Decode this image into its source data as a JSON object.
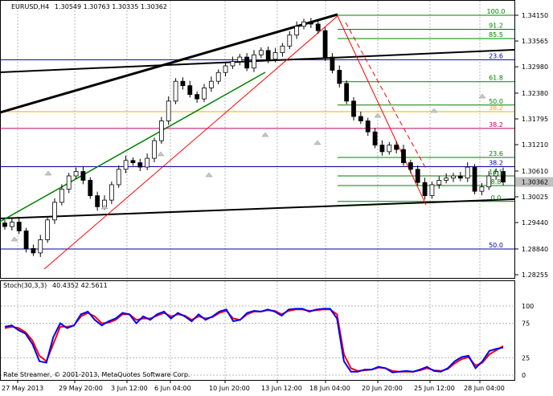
{
  "header": {
    "symbol": "EURUSD,H4",
    "ohlc": "1.30549 1.30763 1.30335 1.30362"
  },
  "chart_data": [
    {
      "type": "candlestick",
      "symbol": "EURUSD",
      "timeframe": "H4",
      "open": 1.30549,
      "high": 1.30763,
      "low": 1.30335,
      "close": 1.30362,
      "ylim": [
        1.28255,
        1.3415
      ],
      "price_ticks": [
        "1.34150",
        "1.33565",
        "1.32980",
        "1.32380",
        "1.31795",
        "1.31210",
        "1.30610",
        "1.30025",
        "1.29440",
        "1.28840",
        "1.28255"
      ],
      "current_price": "1.30362",
      "time_ticks": [
        "27 May 2013",
        "29 May 20:00",
        "3 Jun 12:00",
        "6 Jun 04:00",
        "10 Jun 20:00",
        "13 Jun 12:00",
        "18 Jun 04:00",
        "20 Jun 20:00",
        "25 Jun 12:00",
        "28 Jun 04:00"
      ],
      "close_path": [
        1.2935,
        1.2945,
        1.2925,
        1.2885,
        1.2875,
        1.2905,
        1.295,
        1.299,
        1.302,
        1.305,
        1.306,
        1.304,
        1.3005,
        1.298,
        1.2995,
        1.303,
        1.3065,
        1.3085,
        1.308,
        1.307,
        1.309,
        1.313,
        1.3175,
        1.322,
        1.3265,
        1.3255,
        1.3235,
        1.3225,
        1.325,
        1.3265,
        1.3285,
        1.33,
        1.331,
        1.332,
        1.3295,
        1.3325,
        1.3335,
        1.3315,
        1.333,
        1.3345,
        1.337,
        1.339,
        1.34,
        1.3395,
        1.338,
        1.332,
        1.329,
        1.326,
        1.322,
        1.3185,
        1.3175,
        1.315,
        1.312,
        1.3105,
        1.312,
        1.311,
        1.308,
        1.3065,
        1.3035,
        1.3005,
        1.303,
        1.304,
        1.3045,
        1.305,
        1.3045,
        1.307,
        1.3015,
        1.3025,
        1.305,
        1.306,
        1.3036
      ],
      "fibo_levels_right": [
        {
          "label": "100.0",
          "price": 1.3415,
          "color": "#008000"
        },
        {
          "label": "91.2",
          "price": 1.3383,
          "color": "#008000"
        },
        {
          "label": "85.5",
          "price": 1.3362,
          "color": "#008000"
        },
        {
          "label": "23.6",
          "price": 1.3314,
          "color": "#0000a0"
        },
        {
          "label": "61.8",
          "price": 1.3264,
          "color": "#008000"
        },
        {
          "label": "50.0",
          "price": 1.3211,
          "color": "#008000"
        },
        {
          "label": "38.2",
          "price": 1.3196,
          "color": "#ffa500"
        },
        {
          "label": "38.2",
          "price": 1.3158,
          "color": "#c00060"
        },
        {
          "label": "23.6",
          "price": 1.3092,
          "color": "#008000"
        },
        {
          "label": "38.2",
          "price": 1.3071,
          "color": "#0000a0"
        },
        {
          "label": "14.5",
          "price": 1.305,
          "color": "#008000"
        },
        {
          "label": "8.8",
          "price": 1.3028,
          "color": "#008000"
        },
        {
          "label": "0.0",
          "price": 1.2992,
          "color": "#008000"
        },
        {
          "label": "50.0",
          "price": 1.2884,
          "color": "#0000a0"
        }
      ]
    },
    {
      "type": "line",
      "name": "Stoch(30,3,3)",
      "values_text": "40.4352 42.5611",
      "ylim": [
        0,
        100
      ],
      "levels": [
        "100",
        "75",
        "25",
        "0"
      ],
      "main_line": [
        70,
        72,
        65,
        60,
        45,
        20,
        18,
        55,
        75,
        68,
        72,
        88,
        92,
        80,
        72,
        78,
        82,
        90,
        88,
        75,
        85,
        80,
        88,
        92,
        82,
        90,
        85,
        78,
        88,
        80,
        85,
        92,
        95,
        78,
        80,
        90,
        93,
        92,
        95,
        92,
        86,
        95,
        96,
        96,
        92,
        95,
        96,
        96,
        82,
        20,
        5,
        5,
        8,
        8,
        12,
        10,
        4,
        5,
        6,
        5,
        8,
        12,
        6,
        5,
        10,
        20,
        26,
        28,
        10,
        20,
        35,
        38,
        40
      ],
      "signal_line": [
        68,
        70,
        68,
        62,
        50,
        28,
        20,
        45,
        70,
        70,
        72,
        85,
        90,
        85,
        75,
        76,
        80,
        88,
        88,
        80,
        82,
        82,
        86,
        90,
        85,
        88,
        86,
        80,
        85,
        82,
        84,
        90,
        93,
        82,
        80,
        88,
        92,
        92,
        94,
        93,
        88,
        93,
        95,
        95,
        93,
        94,
        95,
        95,
        88,
        30,
        10,
        6,
        7,
        8,
        11,
        10,
        6,
        5,
        5,
        5,
        7,
        10,
        7,
        6,
        9,
        17,
        23,
        26,
        14,
        18,
        30,
        36,
        42
      ]
    }
  ],
  "footer": {
    "copyright": "Rate Streamer, © 2001-2013, MetaQuotes Software Corp."
  },
  "colors": {
    "bull_candle": "#ffffff",
    "bear_candle": "#000000",
    "stoch_main": "#0000ff",
    "stoch_signal": "#ff0000",
    "trend_green": "#008000",
    "channel_red": "#ff0000",
    "current_price_bg": "#c0c0c0"
  }
}
